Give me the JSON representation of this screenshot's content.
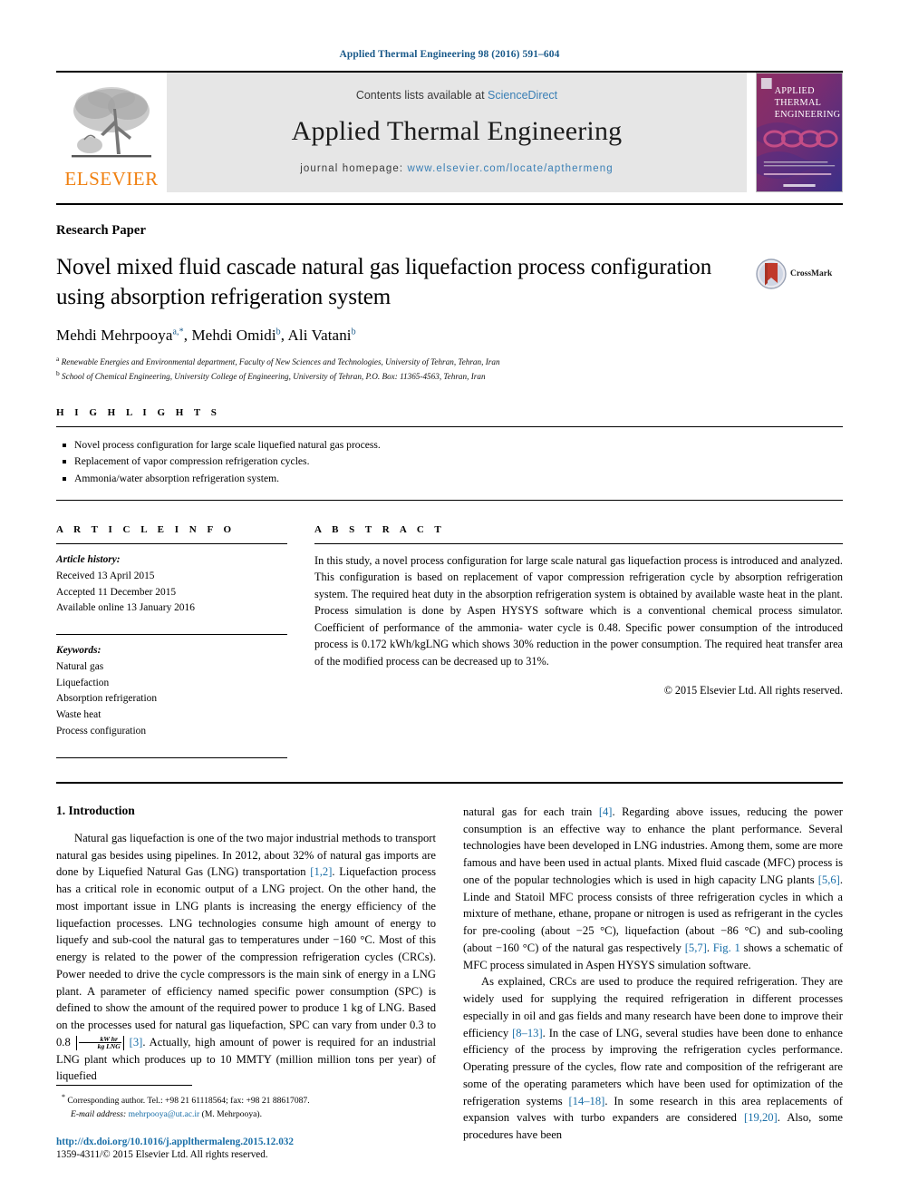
{
  "running_head": "Applied Thermal Engineering 98 (2016) 591–604",
  "masthead": {
    "contents_prefix": "Contents lists available at ",
    "contents_link": "ScienceDirect",
    "journal_title": "Applied Thermal Engineering",
    "homepage_prefix": "journal homepage: ",
    "homepage_url": "www.elsevier.com/locate/apthermeng",
    "publisher": "ELSEVIER",
    "cover_lines": [
      "APPLIED",
      "THERMAL",
      "ENGINEERING"
    ]
  },
  "article": {
    "type": "Research Paper",
    "title": "Novel mixed fluid cascade natural gas liquefaction process configuration using absorption refrigeration system",
    "crossmark_label": "CrossMark",
    "authors": [
      {
        "name": "Mehdi Mehrpooya",
        "marks": "a,*"
      },
      {
        "name": "Mehdi Omidi",
        "marks": "b"
      },
      {
        "name": "Ali Vatani",
        "marks": "b"
      }
    ],
    "affiliations": [
      {
        "mark": "a",
        "text": "Renewable Energies and Environmental department, Faculty of New Sciences and Technologies, University of Tehran, Tehran, Iran"
      },
      {
        "mark": "b",
        "text": "School of Chemical Engineering, University College of Engineering, University of Tehran, P.O. Box: 11365-4563, Tehran, Iran"
      }
    ]
  },
  "highlights": {
    "label": "H I G H L I G H T S",
    "items": [
      "Novel process configuration for large scale liquefied natural gas process.",
      "Replacement of vapor compression refrigeration cycles.",
      "Ammonia/water absorption refrigeration system."
    ]
  },
  "article_info": {
    "label": "A R T I C L E  I N F O",
    "history_label": "Article history:",
    "history": [
      "Received 13 April 2015",
      "Accepted 11 December 2015",
      "Available online 13 January 2016"
    ],
    "keywords_label": "Keywords:",
    "keywords": [
      "Natural gas",
      "Liquefaction",
      "Absorption refrigeration",
      "Waste heat",
      "Process configuration"
    ]
  },
  "abstract": {
    "label": "A B S T R A C T",
    "text": "In this study, a novel process configuration for large scale natural gas liquefaction process is introduced and analyzed. This configuration is based on replacement of vapor compression refrigeration cycle by absorption refrigeration system. The required heat duty in the absorption refrigeration system is obtained by available waste heat in the plant. Process simulation is done by Aspen HYSYS software which is a conventional chemical process simulator. Coefficient of performance of the ammonia- water cycle is 0.48. Specific power consumption of the introduced process is 0.172 kWh/kgLNG which shows 30% reduction in the power consumption. The required heat transfer area of the modified process can be decreased up to 31%.",
    "copyright": "© 2015 Elsevier Ltd. All rights reserved."
  },
  "body": {
    "section_heading": "1. Introduction",
    "left_p1_a": "Natural gas liquefaction is one of the two major industrial methods to transport natural gas besides using pipelines. In 2012, about 32% of natural gas imports are done by Liquefied Natural Gas (LNG) transportation ",
    "left_p1_ref1": "[1,2]",
    "left_p1_b": ". Liquefaction process has a critical role in economic output of a LNG project. On the other hand, the most important issue in LNG plants is increasing the energy efficiency of the liquefaction processes. LNG technologies consume high amount of energy to liquefy and sub-cool the natural gas to temperatures under −160 °C. Most of this energy is related to the power of the compression refrigeration cycles (CRCs). Power needed to drive the cycle compressors is the main sink of energy in a LNG plant. A parameter of efficiency named specific power consumption (SPC) is defined to show the amount of the required power to produce 1 kg of LNG. Based on the processes used for natural gas liquefaction, SPC can vary from under 0.3 to 0.8 ",
    "frac_num": "kW hr",
    "frac_den": "kg LNG",
    "left_p1_ref2": "[3]",
    "left_p1_c": ". Actually, high amount of power is required for an industrial LNG plant which produces up to 10 MMTY (million million tons per year) of liquefied",
    "right_p1_a": "natural gas for each train ",
    "right_p1_ref1": "[4]",
    "right_p1_b": ". Regarding above issues, reducing the power consumption is an effective way to enhance the plant performance. Several technologies have been developed in LNG industries. Among them, some are more famous and have been used in actual plants. Mixed fluid cascade (MFC) process is one of the popular technologies which is used in high capacity LNG plants ",
    "right_p1_ref2": "[5,6]",
    "right_p1_c": ". Linde and Statoil MFC process consists of three refrigeration cycles in which a mixture of methane, ethane, propane or nitrogen is used as refrigerant in the cycles for pre-cooling (about −25 °C), liquefaction (about −86 °C) and sub-cooling (about −160 °C) of the natural gas respectively ",
    "right_p1_ref3": "[5,7]",
    "right_p1_d": ". ",
    "right_p1_figref": "Fig. 1",
    "right_p1_e": " shows a schematic of MFC process simulated in Aspen HYSYS simulation software.",
    "right_p2_a": "As explained, CRCs are used to produce the required refrigeration. They are widely used for supplying the required refrigeration in different processes especially in oil and gas fields and many research have been done to improve their efficiency ",
    "right_p2_ref1": "[8–13]",
    "right_p2_b": ". In the case of LNG, several studies have been done to enhance efficiency of the process by improving the refrigeration cycles performance. Operating pressure of the cycles, flow rate and composition of the refrigerant are some of the operating parameters which have been used for optimization of the refrigeration systems ",
    "right_p2_ref2": "[14–18]",
    "right_p2_c": ". In some research in this area replacements of expansion valves with turbo expanders are considered ",
    "right_p2_ref3": "[19,20]",
    "right_p2_d": ". Also, some procedures have been"
  },
  "footer": {
    "corresponding_mark": "*",
    "corresponding_text": "Corresponding author. Tel.: +98 21 61118564; fax: +98 21 88617087.",
    "email_label": "E-mail address:",
    "email": "mehrpooya@ut.ac.ir",
    "email_suffix": "(M. Mehrpooya).",
    "doi": "http://dx.doi.org/10.1016/j.applthermaleng.2015.12.032",
    "issn": "1359-4311/© 2015 Elsevier Ltd. All rights reserved."
  },
  "colors": {
    "link": "#1a6fa8",
    "running_head": "#1a5a8a",
    "elsevier_orange": "#f08010",
    "band_gray": "#e6e6e6"
  }
}
